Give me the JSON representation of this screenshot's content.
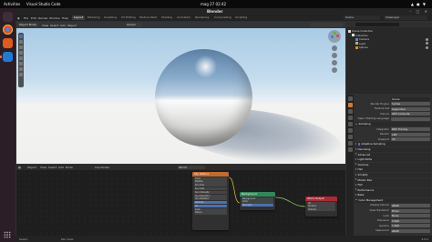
{
  "os": {
    "activities": "Activities",
    "active_app": "Visual Studio Code",
    "clock": "mag 27  02:42"
  },
  "dock": [
    "app-grid-icon",
    "chrome-icon",
    "ubuntu-software-icon",
    "vscode-icon"
  ],
  "window": {
    "title": "Blender"
  },
  "menubar": {
    "menus": [
      "File",
      "Edit",
      "Render",
      "Window",
      "Help"
    ],
    "workspaces": [
      "Layout",
      "Modeling",
      "Sculpting",
      "UV Editing",
      "Texture Paint",
      "Shading",
      "Animation",
      "Rendering",
      "Compositing",
      "Scripting"
    ],
    "active_workspace": "Layout",
    "scene": "Scene",
    "view_layer": "ViewLayer"
  },
  "viewport": {
    "mode": "Object Mode",
    "menus": [
      "View",
      "Select",
      "Add",
      "Object"
    ],
    "orientation": "Global"
  },
  "node_editor": {
    "menus": [
      "Object",
      "View",
      "Select",
      "Add",
      "Node",
      "Use Nodes"
    ],
    "shader_type": "World",
    "nodes": {
      "texture": {
        "title": "Sky Texture",
        "rows": [
          "Color",
          "Nishita",
          "Sun Disc",
          "Sun Size",
          "Sun Intensity",
          "Sun Elevation",
          "Sun Rotation",
          "Altitude",
          "Air",
          "Dust",
          "Ozone"
        ]
      },
      "background": {
        "title": "Background",
        "rows": [
          "Background",
          "Color",
          "Strength"
        ]
      },
      "output": {
        "title": "World Output",
        "rows": [
          "All",
          "Surface",
          "Volume"
        ]
      }
    }
  },
  "outliner": {
    "rows": [
      {
        "label": "Scene Collection",
        "indent": 0
      },
      {
        "label": "Collection",
        "indent": 1
      },
      {
        "label": "Camera",
        "indent": 2
      },
      {
        "label": "Light",
        "indent": 2
      },
      {
        "label": "Sphere",
        "indent": 2
      }
    ]
  },
  "properties": {
    "items": [
      {
        "kind": "row",
        "label": "",
        "value": "Scene"
      },
      {
        "kind": "row",
        "label": "Render Engine",
        "value": "Cycles"
      },
      {
        "kind": "row",
        "label": "Feature Set",
        "value": "Supported"
      },
      {
        "kind": "row",
        "label": "Device",
        "value": "GPU Compute"
      },
      {
        "kind": "row",
        "label": "Open Shading Language",
        "value": ""
      },
      {
        "kind": "sec",
        "label": "Sampling",
        "open": true
      },
      {
        "kind": "row",
        "label": "Integrator",
        "value": "Path Tracing"
      },
      {
        "kind": "row",
        "label": "Render",
        "value": "128"
      },
      {
        "kind": "row",
        "label": "Viewport",
        "value": "32"
      },
      {
        "kind": "sec",
        "label": "Adaptive Sampling",
        "open": false,
        "check": true
      },
      {
        "kind": "sec",
        "label": "Denoising",
        "open": false
      },
      {
        "kind": "sec",
        "label": "Advanced",
        "open": false
      },
      {
        "kind": "sec",
        "label": "Light Paths",
        "open": false
      },
      {
        "kind": "sec",
        "label": "Volumes",
        "open": false
      },
      {
        "kind": "sec",
        "label": "Hair",
        "open": false
      },
      {
        "kind": "sec",
        "label": "Simplify",
        "open": false
      },
      {
        "kind": "sec",
        "label": "Motion Blur",
        "open": false
      },
      {
        "kind": "sec",
        "label": "Film",
        "open": false
      },
      {
        "kind": "sec",
        "label": "Performance",
        "open": false
      },
      {
        "kind": "sec",
        "label": "Bake",
        "open": false
      },
      {
        "kind": "sec",
        "label": "Color Management",
        "open": true
      },
      {
        "kind": "row",
        "label": "Display Device",
        "value": "sRGB"
      },
      {
        "kind": "row",
        "label": "View Transform",
        "value": "Filmic"
      },
      {
        "kind": "row",
        "label": "Look",
        "value": "None"
      },
      {
        "kind": "row",
        "label": "Exposure",
        "value": "0.000"
      },
      {
        "kind": "row",
        "label": "Gamma",
        "value": "1.000"
      },
      {
        "kind": "row",
        "label": "Sequencer",
        "value": "sRGB"
      }
    ]
  },
  "statusbar": {
    "left": "Select",
    "mid": "Pan View",
    "right": "3.0.0"
  },
  "colors": {
    "accent": "#4772b3",
    "texture_node_header": "#c46a2a",
    "background_node_header": "#2d8a58",
    "output_node_header": "#b02735",
    "link_color": "#e8c93a"
  }
}
